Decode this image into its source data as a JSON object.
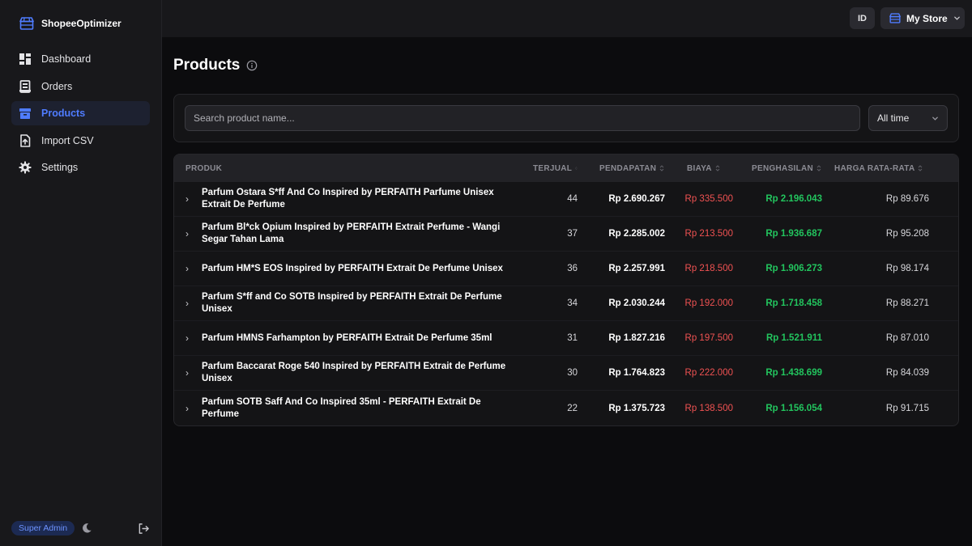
{
  "app": {
    "name": "ShopeeOptimizer",
    "accent": "#4f7cff"
  },
  "sidebar": {
    "items": [
      {
        "label": "Dashboard",
        "icon": "dashboard-icon"
      },
      {
        "label": "Orders",
        "icon": "orders-icon"
      },
      {
        "label": "Products",
        "icon": "products-icon",
        "active": true
      },
      {
        "label": "Import CSV",
        "icon": "import-icon"
      },
      {
        "label": "Settings",
        "icon": "gear-icon"
      }
    ],
    "role": "Super Admin"
  },
  "topbar": {
    "language": "ID",
    "store": "My Store"
  },
  "page": {
    "title": "Products"
  },
  "filters": {
    "search_placeholder": "Search product name...",
    "period": "All time"
  },
  "table": {
    "columns": [
      "PRODUK",
      "TERJUAL",
      "PENDAPATAN",
      "BIAYA",
      "PENGHASILAN",
      "HARGA RATA-RATA"
    ],
    "rows": [
      {
        "name": "Parfum Ostara S*ff And Co Inspired by PERFAITH Parfume Unisex Extrait De Perfume",
        "sold": "44",
        "revenue": "Rp 2.690.267",
        "cost": "Rp 335.500",
        "income": "Rp 2.196.043",
        "avg": "Rp 89.676"
      },
      {
        "name": "Parfum Bl*ck Opium Inspired by PERFAITH Extrait Perfume - Wangi Segar Tahan Lama",
        "sold": "37",
        "revenue": "Rp 2.285.002",
        "cost": "Rp 213.500",
        "income": "Rp 1.936.687",
        "avg": "Rp 95.208"
      },
      {
        "name": "Parfum HM*S EOS Inspired by PERFAITH Extrait De Perfume Unisex",
        "sold": "36",
        "revenue": "Rp 2.257.991",
        "cost": "Rp 218.500",
        "income": "Rp 1.906.273",
        "avg": "Rp 98.174"
      },
      {
        "name": "Parfum S*ff and Co SOTB Inspired by PERFAITH Extrait De Perfume Unisex",
        "sold": "34",
        "revenue": "Rp 2.030.244",
        "cost": "Rp 192.000",
        "income": "Rp 1.718.458",
        "avg": "Rp 88.271"
      },
      {
        "name": "Parfum HMNS Farhampton by PERFAITH Extrait De Perfume 35ml",
        "sold": "31",
        "revenue": "Rp 1.827.216",
        "cost": "Rp 197.500",
        "income": "Rp 1.521.911",
        "avg": "Rp 87.010"
      },
      {
        "name": "Parfum Baccarat Roge 540 Inspired by PERFAITH Extrait de Perfume Unisex",
        "sold": "30",
        "revenue": "Rp 1.764.823",
        "cost": "Rp 222.000",
        "income": "Rp 1.438.699",
        "avg": "Rp 84.039"
      },
      {
        "name": "Parfum SOTB Saff And Co Inspired 35ml - PERFAITH Extrait De Perfume",
        "sold": "22",
        "revenue": "Rp 1.375.723",
        "cost": "Rp 138.500",
        "income": "Rp 1.156.054",
        "avg": "Rp 91.715"
      }
    ]
  }
}
